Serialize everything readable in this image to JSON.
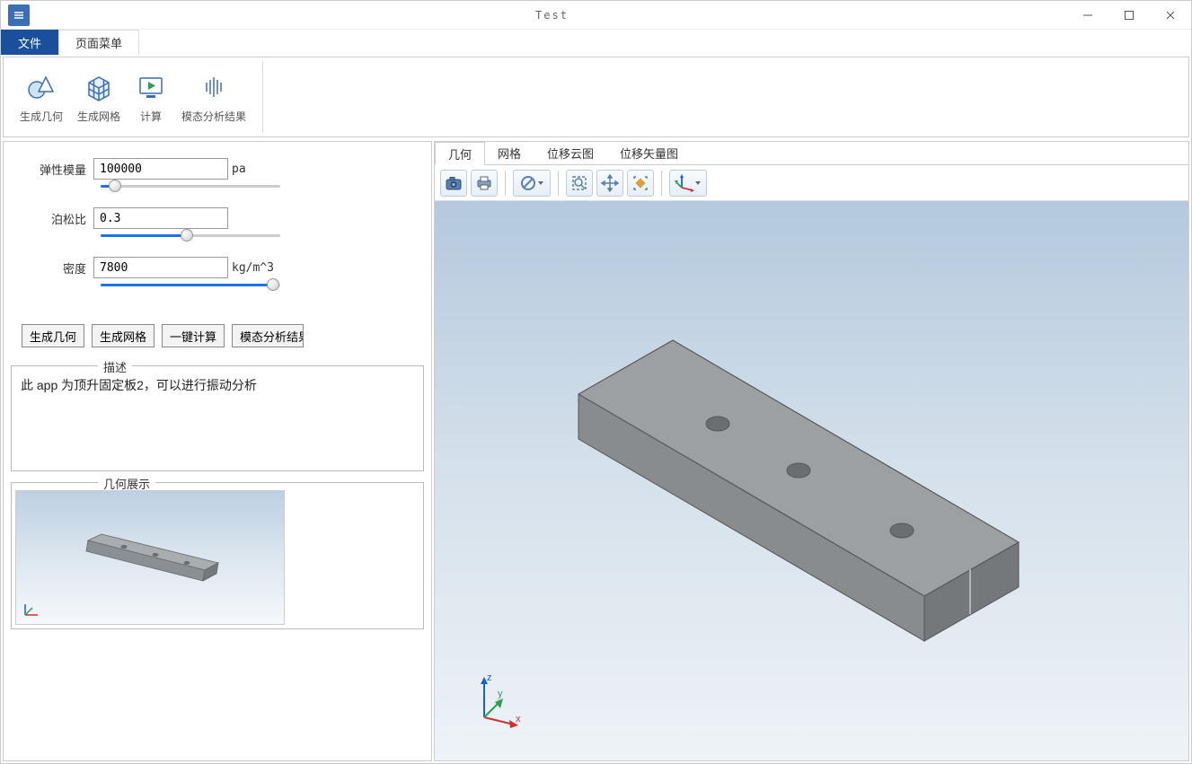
{
  "window": {
    "title": "Test"
  },
  "menu": {
    "file": "文件",
    "pagemenu": "页面菜单"
  },
  "ribbon": {
    "gen_geom": "生成几何",
    "gen_mesh": "生成网格",
    "compute": "计算",
    "modal_results": "模态分析结果"
  },
  "params": {
    "elastic": {
      "label": "弹性模量",
      "value": "100000",
      "unit": "pa",
      "slider_pct": 8
    },
    "poisson": {
      "label": "泊松比",
      "value": "0.3",
      "slider_pct": 48
    },
    "density": {
      "label": "密度",
      "value": "7800",
      "unit": "kg/m^3",
      "slider_pct": 96
    }
  },
  "buttons": {
    "gen_geom": "生成几何",
    "gen_mesh": "生成网格",
    "one_click": "一键计算",
    "modal_trunc": "模态分析结果"
  },
  "fieldsets": {
    "desc_legend": "描述",
    "desc_text": "此 app 为顶升固定板2，可以进行振动分析",
    "geom_legend": "几何展示"
  },
  "view_tabs": {
    "geom": "几何",
    "mesh": "网格",
    "disp_cloud": "位移云图",
    "disp_vec": "位移矢量图"
  },
  "axes": {
    "x": "x",
    "y": "y",
    "z": "z"
  },
  "toolbar_icons": {
    "camera": "camera-icon",
    "print": "print-icon",
    "nosign": "no-entry-icon",
    "zoombox": "zoom-box-icon",
    "pan": "pan-icon",
    "fit": "zoom-fit-icon",
    "axes": "axes-icon"
  }
}
